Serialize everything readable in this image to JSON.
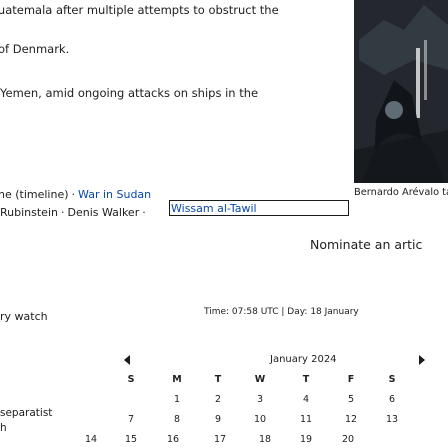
{
  "news": {
    "line1": "Guatemala after multiple attempts to obstruct the",
    "line2": "of Denmark.",
    "line3": "Yemen, amid ongoing attacks on ships in the"
  },
  "ongoing": {
    "prefix": "ne (timeline)",
    "separator": "·",
    "link": "War in Sudan"
  },
  "recent_deaths": {
    "items": [
      "Rubinstein",
      "Denis Walker",
      "Wissam al-Tawil"
    ],
    "separator": "·"
  },
  "image": {
    "caption": "Bernardo Arévalo taking the oath of office",
    "colors": [
      "#24282e",
      "#d9d9d9",
      "#5f6b75",
      "#0d1014"
    ]
  },
  "nominate": "Nominate an artic",
  "sections": {
    "heading_partial": "ry watch",
    "word_partial": "separatist",
    "letter_partial": "h"
  },
  "calendar": {
    "status": "Time: 07:58 UTC  |  Day: 18 January",
    "month_label": "January 2024",
    "weekdays": [
      "S",
      "M",
      "T",
      "W",
      "T",
      "F",
      "S"
    ],
    "weeks": [
      [
        "",
        "1",
        "2",
        "3",
        "4",
        "5",
        "6"
      ],
      [
        "7",
        "8",
        "9",
        "10",
        "11",
        "12",
        "13"
      ],
      [
        "14",
        "15",
        "16",
        "17",
        "18",
        "19",
        "20"
      ]
    ]
  }
}
